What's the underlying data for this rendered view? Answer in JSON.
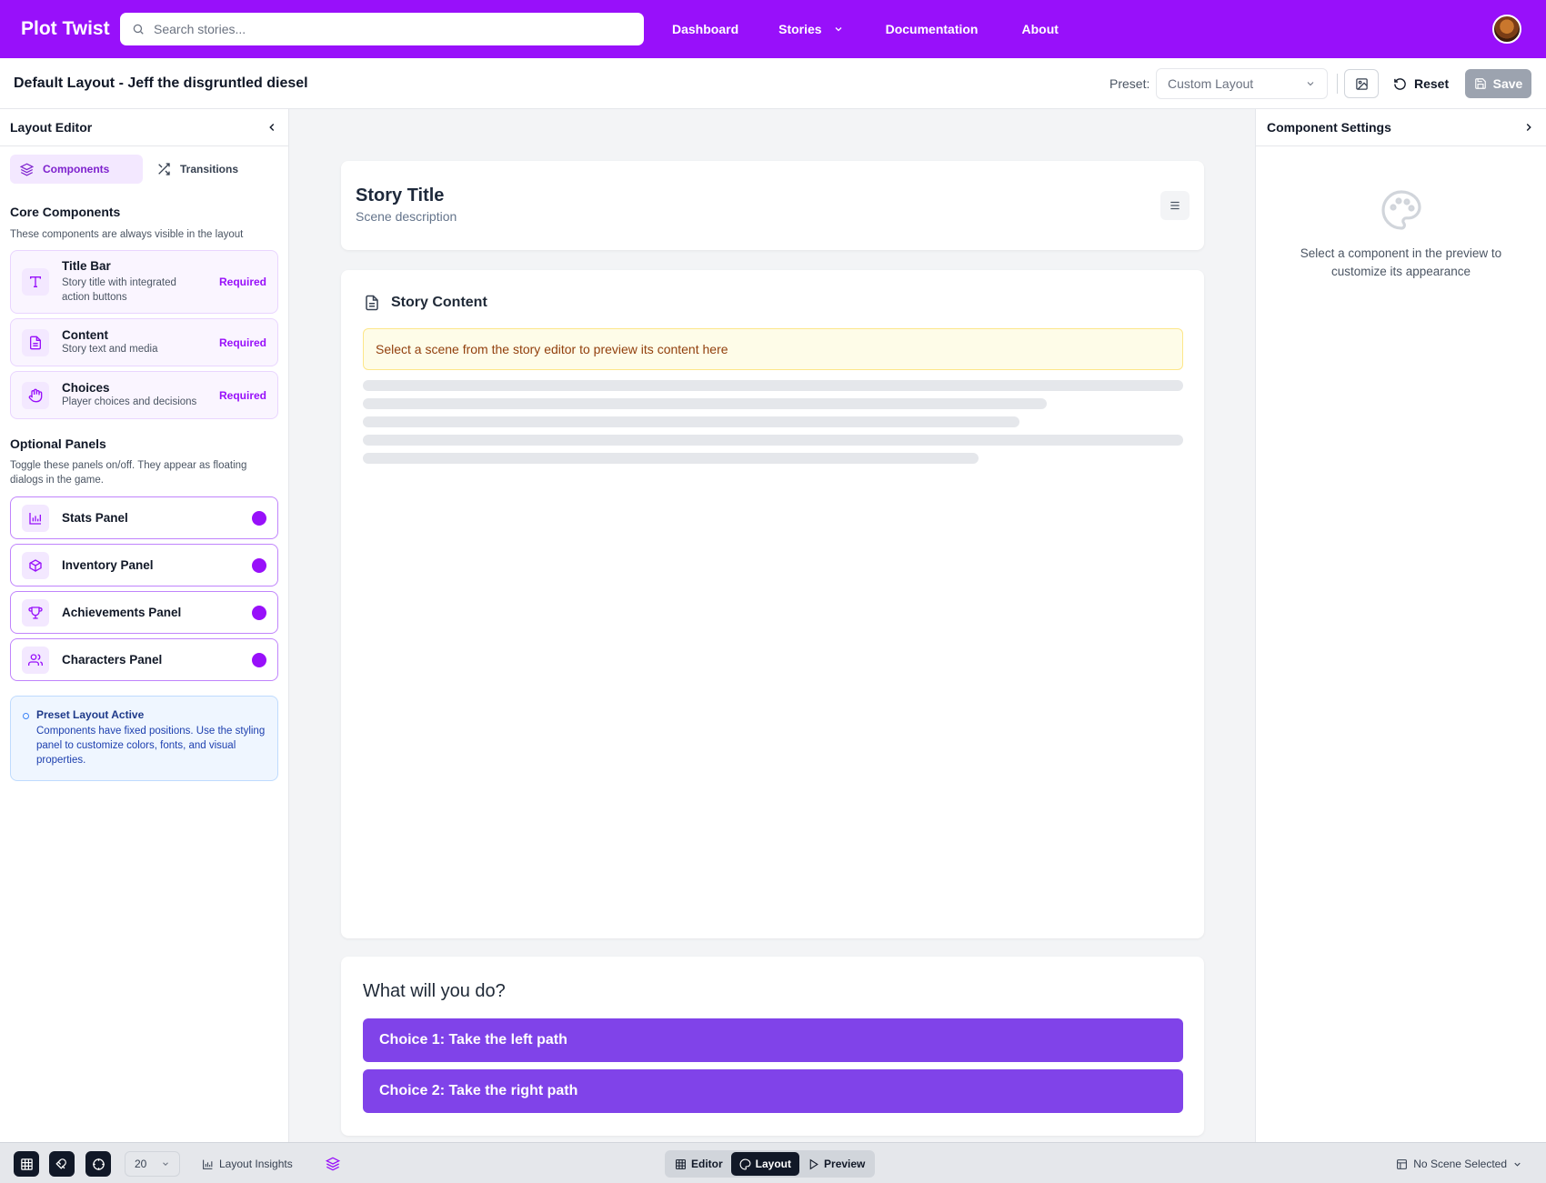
{
  "app": {
    "brand": "Plot Twist",
    "search_placeholder": "Search stories...",
    "nav": [
      "Dashboard",
      "Stories",
      "Documentation",
      "About"
    ]
  },
  "header": {
    "title": "Default Layout - Jeff the disgruntled diesel",
    "preset_label": "Preset:",
    "preset_value": "Custom Layout",
    "reset_label": "Reset",
    "save_label": "Save"
  },
  "left_panel": {
    "title": "Layout Editor",
    "tabs": [
      "Components",
      "Transitions"
    ],
    "core_title": "Core Components",
    "core_desc": "These components are always visible in the layout",
    "core_items": [
      {
        "name": "Title Bar",
        "desc": "Story title with integrated action buttons",
        "badge": "Required",
        "icon": "type-icon"
      },
      {
        "name": "Content",
        "desc": "Story text and media",
        "badge": "Required",
        "icon": "document-icon"
      },
      {
        "name": "Choices",
        "desc": "Player choices and decisions",
        "badge": "Required",
        "icon": "hand-icon"
      }
    ],
    "optional_title": "Optional Panels",
    "optional_desc": "Toggle these panels on/off. They appear as floating dialogs in the game.",
    "optional_items": [
      {
        "name": "Stats Panel",
        "icon": "bar-chart-icon",
        "enabled": true
      },
      {
        "name": "Inventory Panel",
        "icon": "package-icon",
        "enabled": true
      },
      {
        "name": "Achievements Panel",
        "icon": "trophy-icon",
        "enabled": true
      },
      {
        "name": "Characters Panel",
        "icon": "users-icon",
        "enabled": true
      }
    ],
    "info_title": "Preset Layout Active",
    "info_desc": "Components have fixed positions. Use the styling panel to customize colors, fonts, and visual properties."
  },
  "preview": {
    "story_title": "Story Title",
    "scene_description": "Scene description",
    "content_title": "Story Content",
    "notice": "Select a scene from the story editor to preview its content here",
    "choices_title": "What will you do?",
    "choices": [
      "Choice 1: Take the left path",
      "Choice 2: Take the right path"
    ]
  },
  "right_panel": {
    "title": "Component Settings",
    "empty_text": "Select a component in the preview to customize its appearance"
  },
  "bottom_bar": {
    "zoom": "20",
    "insights_label": "Layout Insights",
    "modes": [
      "Editor",
      "Layout",
      "Preview"
    ],
    "active_mode": "Layout",
    "scene_selector": "No Scene Selected"
  },
  "colors": {
    "brand": "#9810fa",
    "choice": "#8043e9",
    "notice_bg": "#fefce8",
    "info_bg": "#eff6ff"
  }
}
